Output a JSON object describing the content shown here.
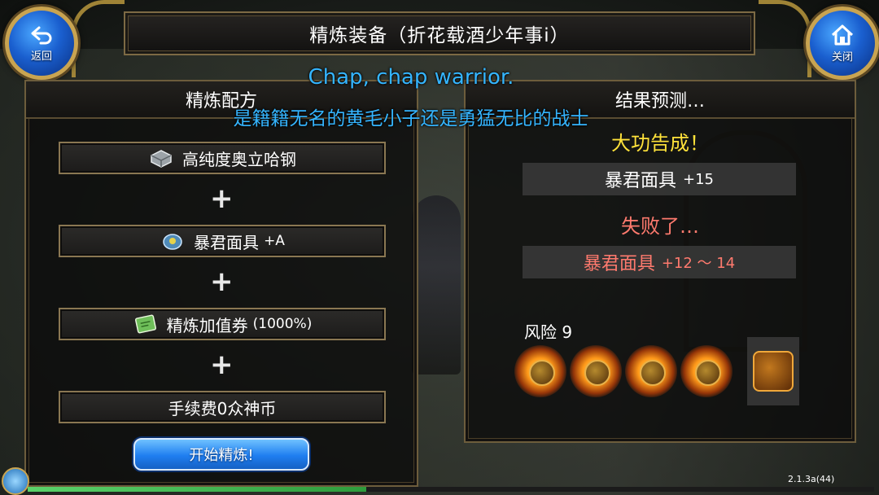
{
  "window": {
    "title": "精炼装备（折花载酒少年事i）",
    "back_label": "返回",
    "close_label": "关闭"
  },
  "subtitles": {
    "line1": "Chap, chap warrior.",
    "line2": "是籍籍无名的黄毛小子还是勇猛无比的战士"
  },
  "recipe_panel": {
    "header": "精炼配方",
    "material": "高纯度奥立哈钢",
    "equipment_name": "暴君面具",
    "equipment_suffix": "+A",
    "ticket_name": "精炼加值券",
    "ticket_suffix": "(1000%)",
    "fee": "手续费0众神币",
    "plus": "+",
    "start_button": "开始精炼!"
  },
  "result_panel": {
    "header": "结果预测…",
    "success_title": "大功告成！",
    "success_item": "暴君面具",
    "success_suffix": "+15",
    "fail_title": "失败了…",
    "fail_item": "暴君面具",
    "fail_suffix": "+12 ～ 14",
    "risk_label": "风险 9",
    "risk_icons": [
      "explosion-icon",
      "explosion-icon",
      "explosion-icon",
      "explosion-icon",
      "explosion-icon"
    ]
  },
  "footer": {
    "version": "2.1.3a(44)",
    "progress": 0.4
  },
  "colors": {
    "accent_blue": "#35b5ff",
    "success": "#ffe23a",
    "fail": "#ff7a6e",
    "frame_gold": "#b8973d"
  }
}
